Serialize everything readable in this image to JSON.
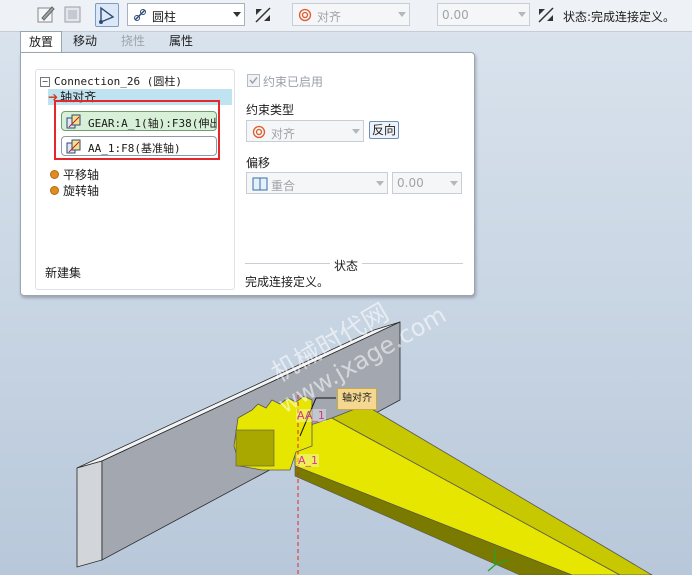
{
  "toolbar": {
    "icons": [
      "dashboard-settings-icon",
      "layer-icon",
      "constraint-mode-icon",
      "flip-icon",
      "dimension-axis-icon"
    ],
    "connection_type": "圆柱",
    "constraint_type": "对齐",
    "offset_value": "0.00",
    "status": "状态:完成连接定义。"
  },
  "tabs": [
    "放置",
    "移动",
    "挠性",
    "属性"
  ],
  "tree": {
    "root": "Connection_26 (圆柱)",
    "selected_set": "轴对齐",
    "refs": [
      "GEAR:A_1(轴):F38(伸出",
      "AA_1:F8(基准轴)"
    ],
    "sets": [
      "平移轴",
      "旋转轴"
    ],
    "new_set": "新建集"
  },
  "props": {
    "enabled_label": "约束已启用",
    "constraint_type_label": "约束类型",
    "constraint_type_value": "对齐",
    "reverse_label": "反向",
    "offset_label": "偏移",
    "offset_type": "重合",
    "offset_value": "0.00",
    "status_header": "状态",
    "status_text": "完成连接定义。"
  },
  "viewport": {
    "annotation": "轴对齐",
    "axis_label_1": "AA_1",
    "axis_label_2": "A_1",
    "watermark_cn": "机械时代网",
    "watermark_url": "www.jxage.com"
  },
  "colors": {
    "accent": "#4a6fa5",
    "highlight": "#e3272b",
    "part_yellow": "#e6e600",
    "selected_row": "#bfe3f0"
  }
}
